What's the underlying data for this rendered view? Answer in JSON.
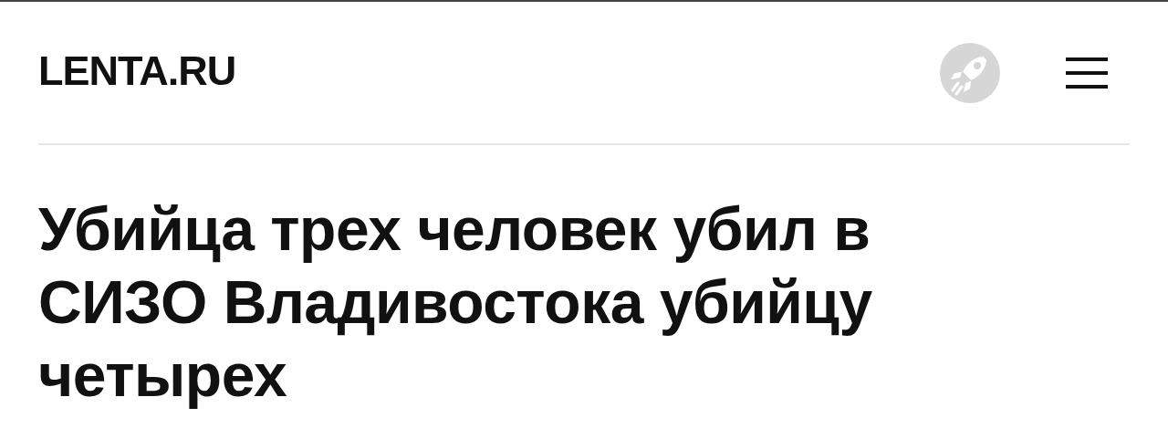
{
  "header": {
    "logo": "LENTA.RU"
  },
  "article": {
    "headline": "Убийца трех человек убил в СИЗО Владивостока убийцу четырех"
  }
}
